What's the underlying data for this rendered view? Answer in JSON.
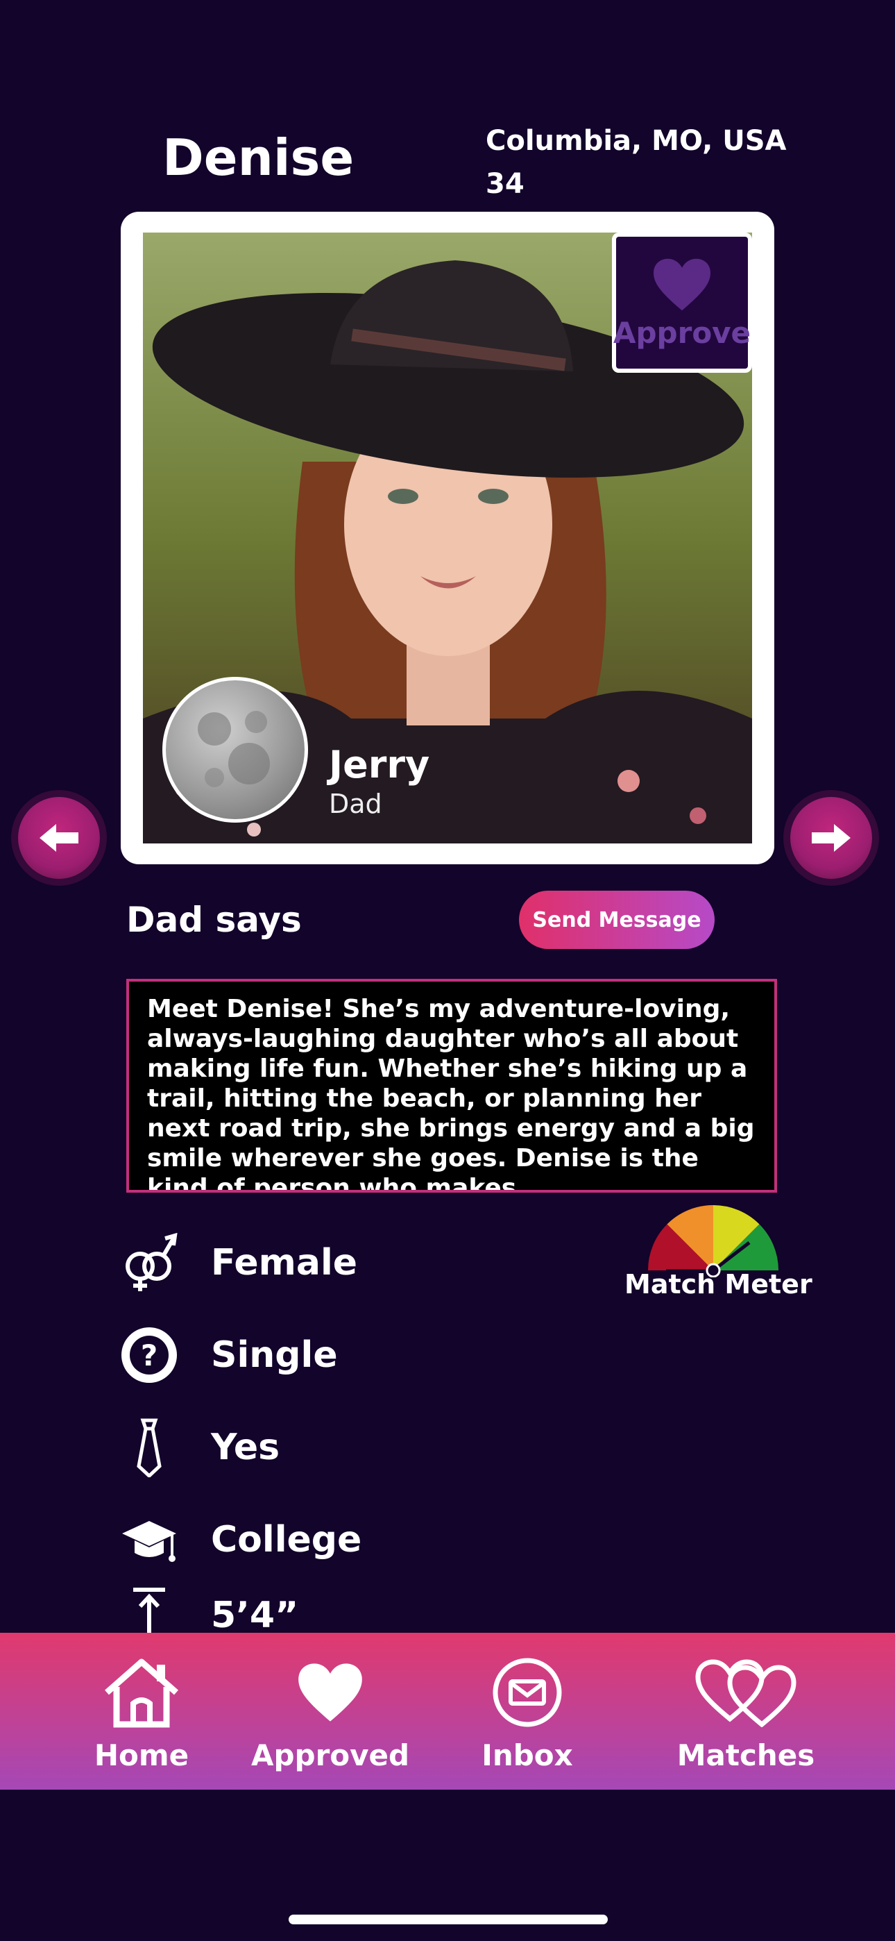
{
  "profile": {
    "name": "Denise",
    "location": "Columbia, MO, USA",
    "age": "34"
  },
  "photo": {
    "approve_label": "Approve"
  },
  "sponsor": {
    "name": "Jerry",
    "relation": "Dad"
  },
  "says": {
    "title": "Dad says",
    "send_label": "Send Message",
    "bio": "Meet Denise! She’s my adventure-loving, always-laughing daughter who’s all about making life fun. Whether she’s hiking up a trail, hitting the beach, or planning her next road trip, she brings energy and a big smile wherever she goes. Denise is the kind of person who makes"
  },
  "attributes": [
    {
      "icon": "gender-icon",
      "label": "Female"
    },
    {
      "icon": "question-circle-icon",
      "label": "Single"
    },
    {
      "icon": "tie-icon",
      "label": "Yes"
    },
    {
      "icon": "graduation-cap-icon",
      "label": "College"
    },
    {
      "icon": "height-icon",
      "label": "5’4”"
    }
  ],
  "match_meter": {
    "label": "Match Meter",
    "colors": [
      "#b0102a",
      "#f0902a",
      "#d8d81e",
      "#1f9a3a"
    ]
  },
  "nav": {
    "items": [
      {
        "label": "Home",
        "icon": "home-icon"
      },
      {
        "label": "Approved",
        "icon": "heart-icon"
      },
      {
        "label": "Inbox",
        "icon": "mail-icon"
      },
      {
        "label": "Matches",
        "icon": "double-heart-icon"
      }
    ]
  },
  "colors": {
    "background": "#12042a",
    "accent_pink": "#e0306a",
    "accent_purple": "#a548b6"
  }
}
